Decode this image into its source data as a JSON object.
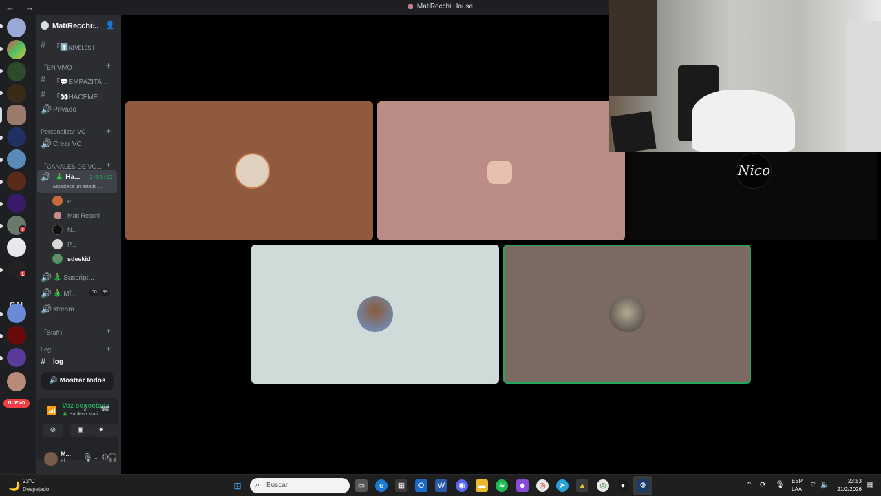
{
  "window": {
    "title": "MatiRecchi House",
    "nav": "← →"
  },
  "server": {
    "name": "MatiRecchi..."
  },
  "channels": {
    "niveles": "「⬆️ɴɪᴠᴇʟᴇs」",
    "cat_en_vivo": "「EN VIVO」",
    "empazitando": "「💬EMPAZITA...",
    "haceme": "「👀HACEME...",
    "privado": "Privado",
    "cat_personalizar": "Personalizar-VC",
    "crear_vc": "Crear VC",
    "cat_canales_voz": "「CANALES DE VO...",
    "hablen": "🎄 Ha...",
    "hablen_time": "2:52:22",
    "hablen_status": "Establece un estado ...",
    "members": [
      {
        "name": "e...",
        "color": "#c86a3c"
      },
      {
        "name": "Mati Recchi",
        "color": "#c98e8a"
      },
      {
        "name": "N...",
        "color": "#111111"
      },
      {
        "name": "P...",
        "color": "#d8d8d8"
      },
      {
        "name": "sdeekid",
        "color": "#6a8a6a"
      }
    ],
    "suscriptores": "🎄 Suscript...",
    "mf": "🎄 Mf...",
    "mf_count_a": "00",
    "mf_count_b": "99",
    "stream": "stream",
    "cat_staff": "「Staff」",
    "cat_log": "Log",
    "log": "log",
    "mostrar_todos": "Mostrar todos"
  },
  "voice_panel": {
    "status": "Voz conectada",
    "channel": "🎄 Hablen / Mati...",
    "user_initial": "M...",
    "user_status": "Ei"
  },
  "guilds": {
    "nuevo": "NUEVO",
    "cai": "CAI",
    "badge_2": "2",
    "badge_1": "1"
  },
  "tiles": {
    "nico_label": "Nico"
  },
  "taskbar": {
    "temp": "23°C",
    "weather": "Despejado",
    "search": "Buscar",
    "lang1": "ESP",
    "lang2": "LAA",
    "time": "23:53",
    "date": "21/2/2026"
  },
  "colors": {
    "tile1": "#8f5a3e",
    "tile2": "#bb8c86",
    "tile3": "#0a0a0a",
    "tile4": "#cfdbd8",
    "tile5": "#7a6a62",
    "speaking": "#23a55a"
  }
}
